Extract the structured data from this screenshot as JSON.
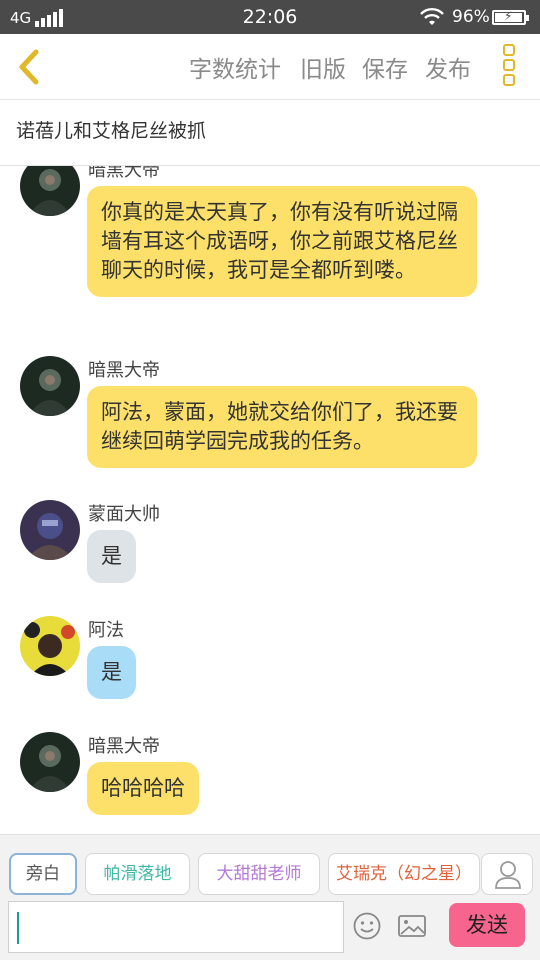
{
  "status_bar": {
    "network": "4G",
    "time": "22:06",
    "battery_percent": "96%"
  },
  "nav": {
    "actions": [
      "字数统计",
      "旧版",
      "保存",
      "发布"
    ],
    "icons": {
      "back": "chevron-left-icon",
      "more": "more-vertical-icon"
    },
    "accent_color": "#e0b82a"
  },
  "story": {
    "title": "诺蓓儿和艾格尼丝被抓"
  },
  "messages": [
    {
      "speaker": "暗黑大帝",
      "text": "你真的是太天真了，你有没有听说过隔墙有耳这个成语呀，你之前跟艾格尼丝聊天的时候，我可是全都听到喽。",
      "bubble": "yellow"
    },
    {
      "speaker": "暗黑大帝",
      "text": "阿法，蒙面，她就交给你们了，我还要继续回萌学园完成我的任务。",
      "bubble": "yellow"
    },
    {
      "speaker": "蒙面大帅",
      "text": "是",
      "bubble": "gray"
    },
    {
      "speaker": "阿法",
      "text": "是",
      "bubble": "blue"
    },
    {
      "speaker": "暗黑大帝",
      "text": "哈哈哈哈",
      "bubble": "yellow"
    }
  ],
  "composer": {
    "roles": [
      "旁白",
      "帕滑落地",
      "大甜甜老师",
      "艾瑞克（幻之星）"
    ],
    "selected_role": "旁白",
    "role_colors": [
      "#555555",
      "#3fb8a6",
      "#b57ad6",
      "#e0623a"
    ],
    "input_value": "",
    "send_label": "发送",
    "send_color": "#f7648d",
    "icons": [
      "person-icon",
      "emoji-icon",
      "image-icon"
    ]
  }
}
